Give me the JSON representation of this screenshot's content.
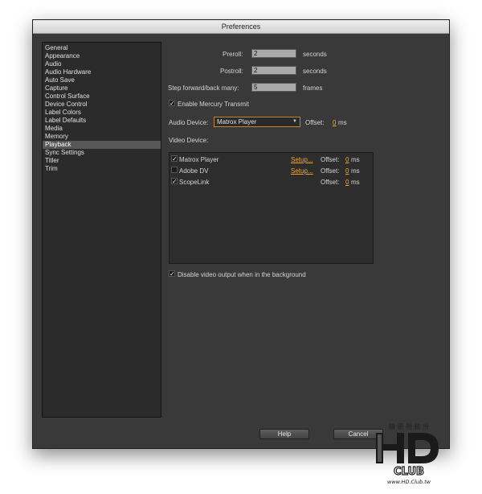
{
  "window": {
    "title": "Preferences"
  },
  "sidebar": {
    "items": [
      {
        "label": "General"
      },
      {
        "label": "Appearance"
      },
      {
        "label": "Audio"
      },
      {
        "label": "Audio Hardware"
      },
      {
        "label": "Auto Save"
      },
      {
        "label": "Capture"
      },
      {
        "label": "Control Surface"
      },
      {
        "label": "Device Control"
      },
      {
        "label": "Label Colors"
      },
      {
        "label": "Label Defaults"
      },
      {
        "label": "Media"
      },
      {
        "label": "Memory"
      },
      {
        "label": "Playback",
        "selected": true
      },
      {
        "label": "Sync Settings"
      },
      {
        "label": "Titler"
      },
      {
        "label": "Trim"
      }
    ]
  },
  "playback": {
    "preroll": {
      "label": "Preroll:",
      "value": "2",
      "unit": "seconds"
    },
    "postroll": {
      "label": "Postroll:",
      "value": "2",
      "unit": "seconds"
    },
    "step": {
      "label": "Step forward/back many:",
      "value": "5",
      "unit": "frames"
    },
    "mercury": {
      "label": "Enable Mercury Transmit",
      "checked": true
    },
    "audio_device": {
      "label": "Audio Device:",
      "selected": "Matrox Player",
      "offset_label": "Offset:",
      "offset_value": "0",
      "offset_unit": "ms"
    },
    "video_device_label": "Video Device:",
    "video_devices": [
      {
        "name": "Matrox Player",
        "checked": true,
        "setup": "Setup...",
        "offset_label": "Offset:",
        "offset_value": "0",
        "offset_unit": "ms"
      },
      {
        "name": "Adobe DV",
        "checked": false,
        "setup": "Setup...",
        "offset_label": "Offset:",
        "offset_value": "0",
        "offset_unit": "ms"
      },
      {
        "name": "ScopeLink",
        "checked": true,
        "setup": "",
        "offset_label": "Offset:",
        "offset_value": "0",
        "offset_unit": "ms"
      }
    ],
    "disable_background": {
      "label": "Disable video output when in the background",
      "checked": true
    }
  },
  "buttons": {
    "help": "Help",
    "cancel": "Cancel"
  },
  "watermark": {
    "top": "精 研 視 務 所",
    "brand": "HD",
    "sub": "CLUB",
    "url": "www.HD.Club.tw"
  },
  "colors": {
    "accent": "#f0a830",
    "window_bg": "#393939",
    "selected_bg": "#575757"
  },
  "glyphs": {
    "check": "✓",
    "dropdown": "▼"
  }
}
